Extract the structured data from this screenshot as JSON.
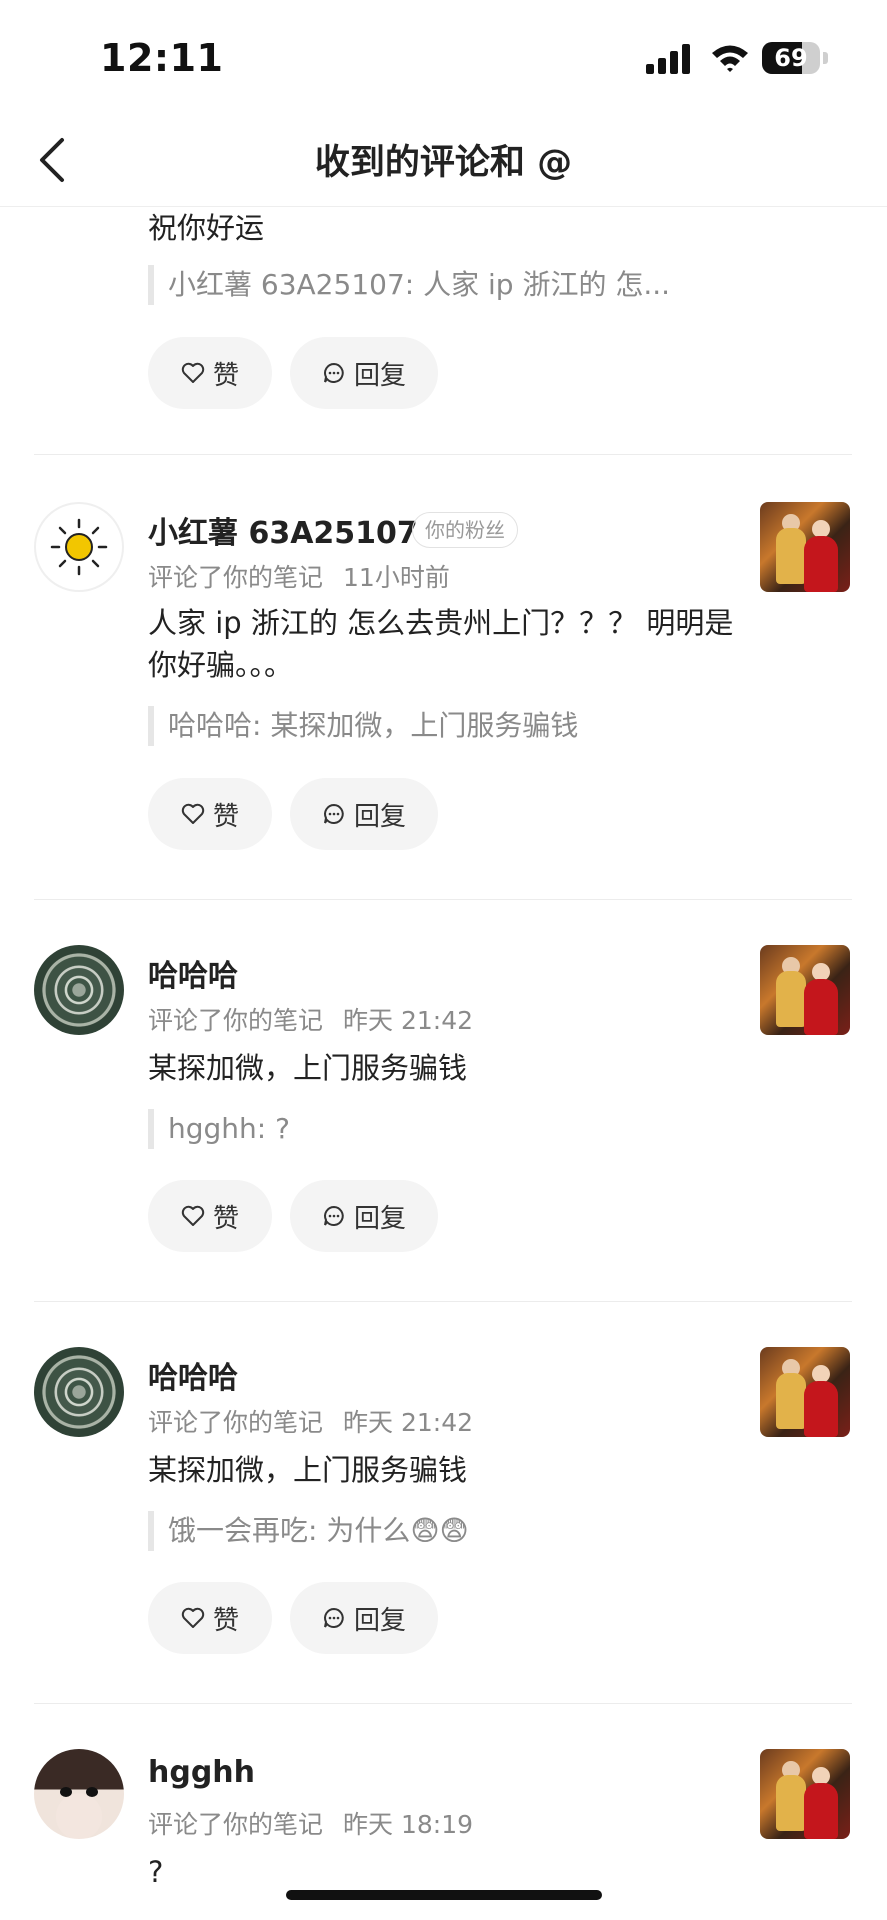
{
  "status_bar": {
    "time": "12:11",
    "battery": "69",
    "battery_level": 0.69
  },
  "nav": {
    "title": "收到的评论和 @"
  },
  "actions": {
    "like": "赞",
    "reply": "回复"
  },
  "items": [
    {
      "content": "祝你好运",
      "quote": "小红薯 63A25107: 人家 ip 浙江的 怎..."
    },
    {
      "username": "小红薯 63A25107",
      "badge": "你的粉丝",
      "action": "评论了你的笔记",
      "time": "11小时前",
      "content": "人家 ip 浙江的 怎么去贵州上门？？？ 明明是你好骗。。。",
      "quote": "哈哈哈: 某探加微，上门服务骗钱"
    },
    {
      "username": "哈哈哈",
      "action": "评论了你的笔记",
      "time": "昨天 21:42",
      "content": "某探加微，上门服务骗钱",
      "quote": "hgghh: ?"
    },
    {
      "username": "哈哈哈",
      "action": "评论了你的笔记",
      "time": "昨天 21:42",
      "content": "某探加微，上门服务骗钱",
      "quote": "饿一会再吃: 为什么",
      "quote_emoji": "😨😨"
    },
    {
      "username": "hgghh",
      "action": "评论了你的笔记",
      "time": "昨天 18:19",
      "content": "?"
    }
  ],
  "icons": {
    "back": "chevron-left-icon",
    "like": "heart-icon",
    "reply": "chat-bubble-icon",
    "signal": "cellular-signal-icon",
    "wifi": "wifi-icon",
    "battery": "battery-icon",
    "sun": "sun-avatar"
  }
}
